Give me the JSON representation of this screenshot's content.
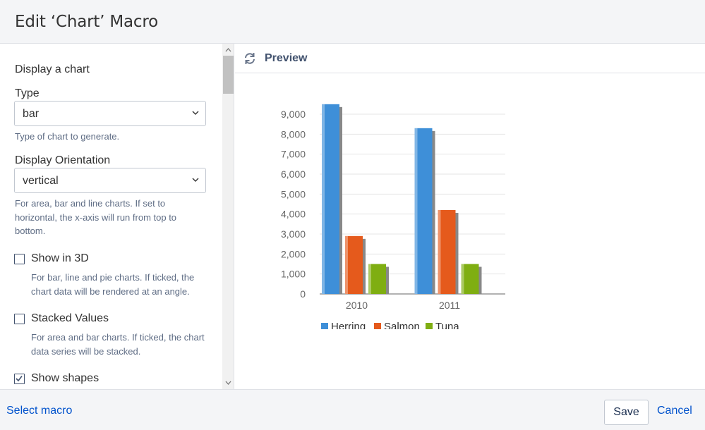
{
  "dialog": {
    "title": "Edit ‘Chart’ Macro"
  },
  "form": {
    "heading": "Display a chart",
    "type": {
      "label": "Type",
      "value": "bar",
      "help": "Type of chart to generate."
    },
    "orientation": {
      "label": "Display Orientation",
      "value": "vertical",
      "help": "For area, bar and line charts. If set to horizontal, the x-axis will run from top to bottom."
    },
    "show3d": {
      "label": "Show in 3D",
      "checked": false,
      "help": "For bar, line and pie charts. If ticked, the chart data will be rendered at an angle."
    },
    "stacked": {
      "label": "Stacked Values",
      "checked": false,
      "help": "For area and bar charts. If ticked, the chart data series will be stacked."
    },
    "shapes": {
      "label": "Show shapes",
      "checked": true
    }
  },
  "preview": {
    "title": "Preview"
  },
  "chart_data": {
    "type": "bar",
    "categories": [
      "2010",
      "2011"
    ],
    "series": [
      {
        "name": "Herring",
        "values": [
          9500,
          8300
        ],
        "color": "#3e8fd8"
      },
      {
        "name": "Salmon",
        "values": [
          2900,
          4200
        ],
        "color": "#e55a1c"
      },
      {
        "name": "Tuna",
        "values": [
          1500,
          1500
        ],
        "color": "#7fae12"
      }
    ],
    "ylim": [
      0,
      9000
    ],
    "yticks": [
      0,
      1000,
      2000,
      3000,
      4000,
      5000,
      6000,
      7000,
      8000,
      9000
    ],
    "ytick_labels": [
      "0",
      "1,000",
      "2,000",
      "3,000",
      "4,000",
      "5,000",
      "6,000",
      "7,000",
      "8,000",
      "9,000"
    ],
    "grid": true,
    "legend": "bottom"
  },
  "footer": {
    "select_macro": "Select macro",
    "save": "Save",
    "cancel": "Cancel"
  }
}
